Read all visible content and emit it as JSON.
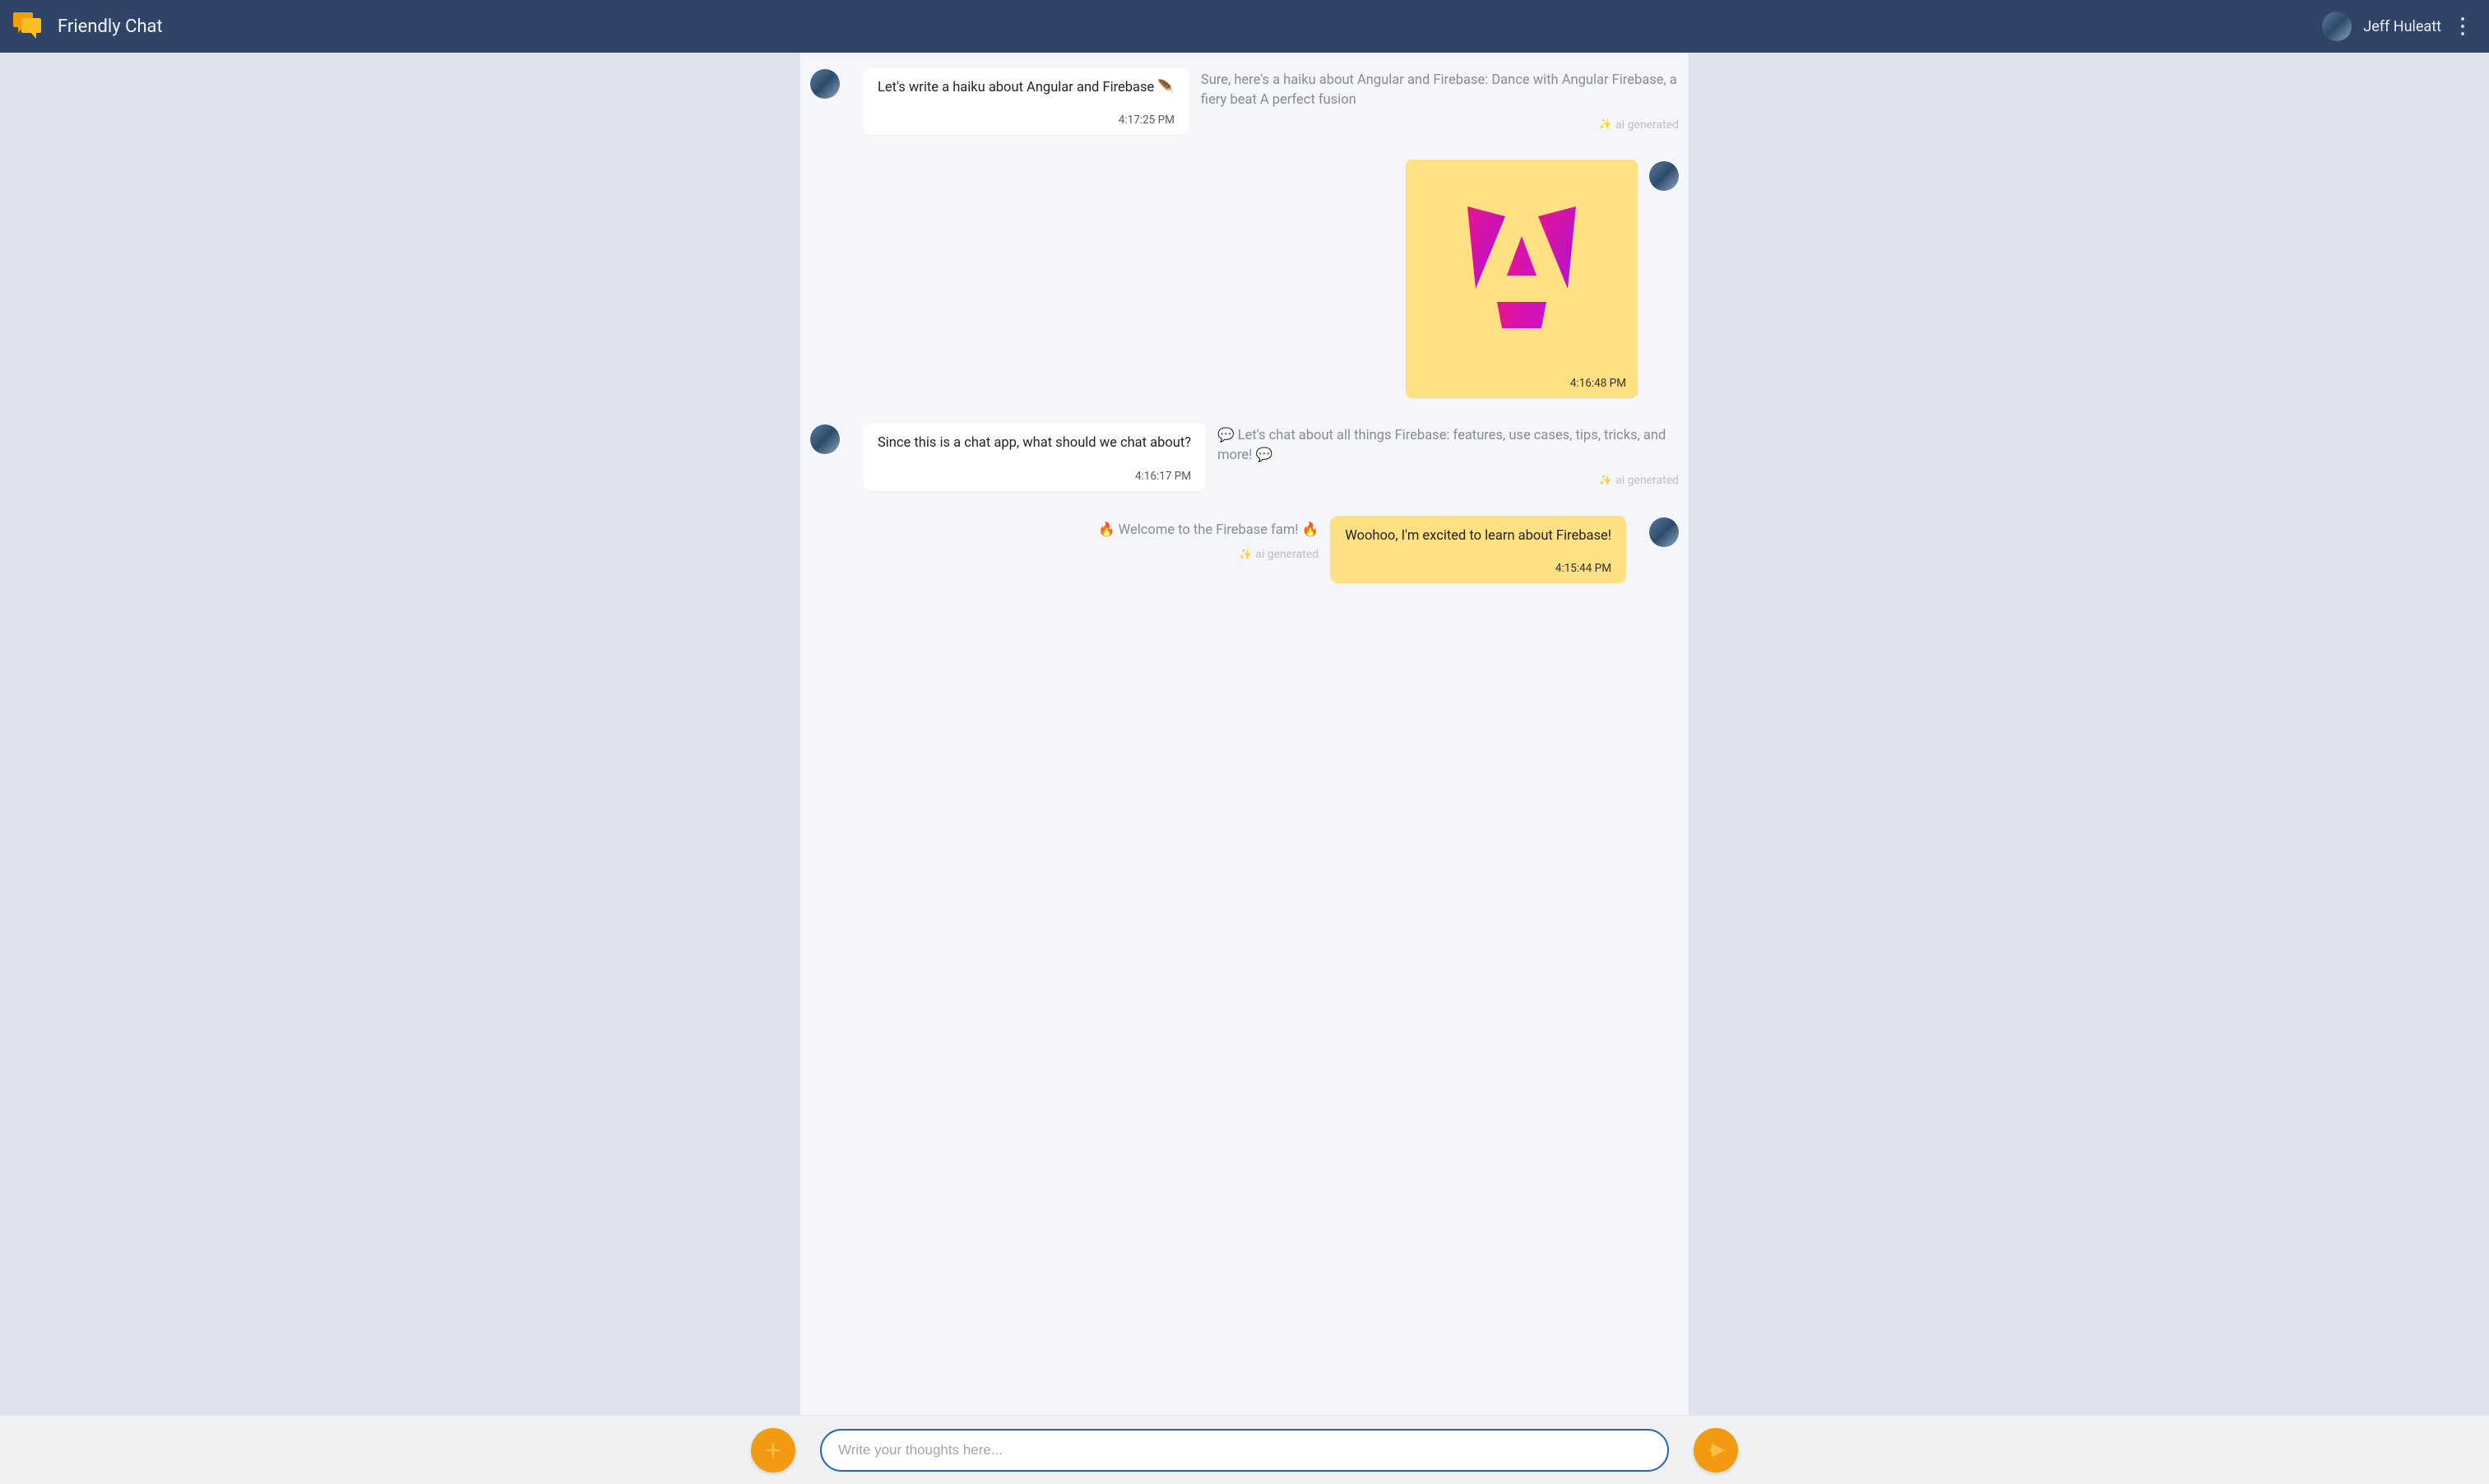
{
  "header": {
    "app_title": "Friendly Chat",
    "user_name": "Jeff Huleatt"
  },
  "ai_generated_label": "ai generated",
  "messages": {
    "m1": {
      "text": "Let's write a haiku about Angular and Firebase 🪶",
      "timestamp": "4:17:25 PM",
      "ai_reply": "Sure, here's a haiku about Angular and Firebase: Dance with Angular Firebase, a fiery beat A perfect fusion"
    },
    "m2": {
      "image_alt": "Angular logo",
      "timestamp": "4:16:48 PM"
    },
    "m3": {
      "text": "Since this is a chat app, what should we chat about?",
      "timestamp": "4:16:17 PM",
      "ai_reply": "💬 Let's chat about all things Firebase: features, use cases, tips, tricks, and more! 💬"
    },
    "m4": {
      "welcome": "🔥 Welcome to the Firebase fam! 🔥",
      "text": "Woohoo, I'm excited to learn about Firebase!",
      "timestamp": "4:15:44 PM"
    }
  },
  "composer": {
    "placeholder": "Write your thoughts here..."
  }
}
